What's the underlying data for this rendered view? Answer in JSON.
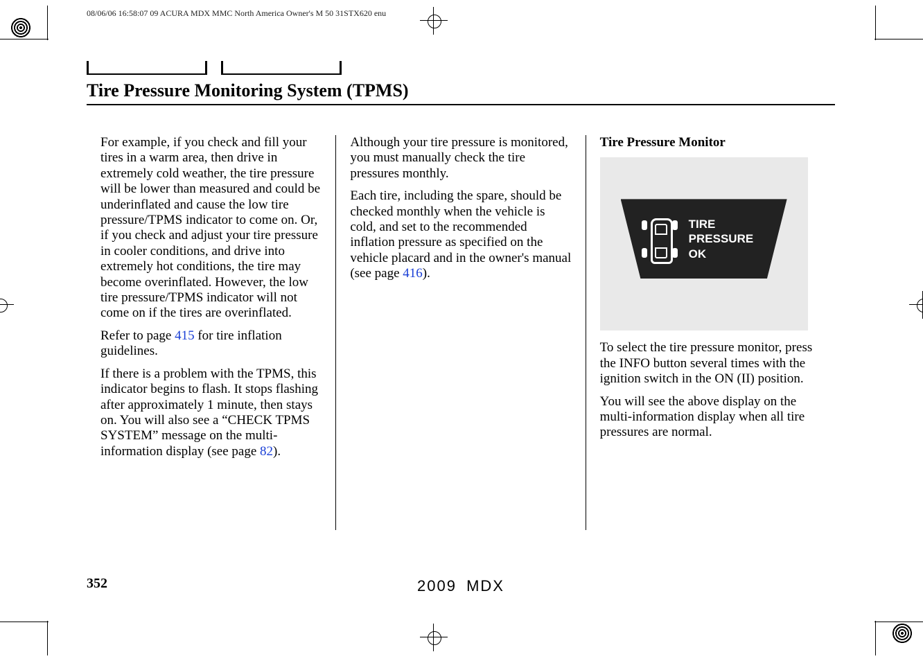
{
  "meta_line": "08/06/06 16:58:07   09 ACURA MDX MMC North America Owner's M 50 31STX620 enu",
  "section_title": "Tire Pressure Monitoring System (TPMS)",
  "col1": {
    "p1": "For example, if you check and fill your tires in a warm area, then drive in extremely cold weather, the tire pressure will be lower than measured and could be underinflated and cause the low tire pressure/TPMS indicator to come on. Or, if you check and adjust your tire pressure in cooler conditions, and drive into extremely hot conditions, the tire may become overinflated. However, the low tire pressure/TPMS indicator will not come on if the tires are overinflated.",
    "p2_pre": "Refer to page ",
    "p2_ref": "415",
    "p2_post": " for tire inflation guidelines.",
    "p3_pre": "If there is a problem with the TPMS, this indicator begins to flash. It stops flashing after approximately 1 minute, then stays on. You will also see a “CHECK TPMS SYSTEM” message on the multi-information display (see page ",
    "p3_ref": "82",
    "p3_post": ")."
  },
  "col2": {
    "p1": "Although your tire pressure is monitored, you must manually check the tire pressures monthly.",
    "p2_pre": "Each tire, including the spare, should be checked monthly when the vehicle is cold, and set to the recommended inflation pressure as specified on the vehicle placard and in the owner's manual (see page ",
    "p2_ref": "416",
    "p2_post": ")."
  },
  "col3": {
    "heading": "Tire Pressure Monitor",
    "display_text": "TIRE\nPRESSURE\nOK",
    "p1": "To select the tire pressure monitor, press the INFO button several times with the ignition switch in the ON (II) position.",
    "p2": "You will see the above display on the multi-information display when all tire pressures are normal."
  },
  "page_number": "352",
  "footer_model": "2009  MDX"
}
